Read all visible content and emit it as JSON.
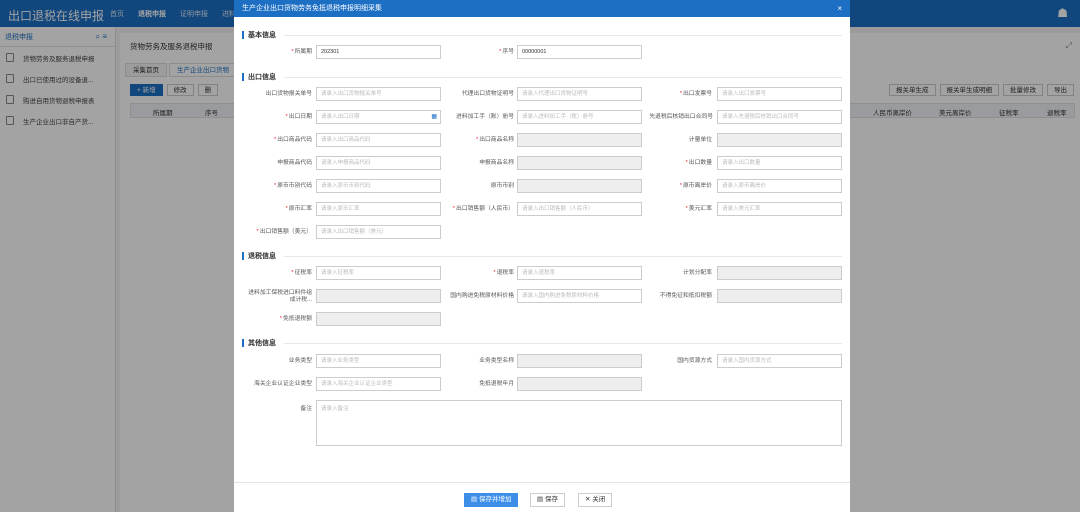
{
  "app": {
    "title": "出口退税在线申报",
    "nav": [
      "首页",
      "退税申报",
      "证明申报",
      "进料"
    ],
    "nav_active": 1,
    "user_icon": "user-icon"
  },
  "sidebar": {
    "title": "退税申报",
    "items": [
      "货物劳务及服务退税申报",
      "出口已使用过的设备退...",
      "购进自用货物退税申报表",
      "生产企业出口非自产货..."
    ]
  },
  "main": {
    "breadcrumb": "货物劳务及服务退税申报",
    "tabs": [
      "采集首页",
      "生产企业出口货物"
    ],
    "toolbar": {
      "new": "+ 新增",
      "edit": "修改",
      "delete": "删"
    },
    "toolbar_right": [
      "报关单生成",
      "报关单生成明细",
      "批量修改",
      "导出"
    ],
    "grid_headers": [
      "所属期",
      "序号",
      "人民币离岸价",
      "美元离岸价",
      "征税率",
      "退税率"
    ]
  },
  "modal": {
    "title": "生产企业出口货物劳务免抵退税申报明细采集",
    "close": "×",
    "sections": {
      "basic": "基本信息",
      "export": "出口信息",
      "refund": "退税信息",
      "other": "其他信息"
    },
    "basic": {
      "period_label": "所属期",
      "period_value": "202301",
      "seq_label": "序号",
      "seq_value": "00000001"
    },
    "export": {
      "customs_no_label": "出口货物报关单号",
      "customs_no_ph": "请录入出口货物报关单号",
      "agent_cert_label": "代理出口货物证明号",
      "agent_cert_ph": "请录入代理出口货物证明号",
      "invoice_label": "出口发票号",
      "invoice_ph": "请录入出口发票号",
      "date_label": "出口日期",
      "date_ph": "请录入出口日期",
      "manual_label": "进料加工手（账）册号",
      "manual_ph": "请录入进料加工手（账）册号",
      "transfer_label": "先退税后核销出口合同号",
      "transfer_ph": "请录入先退税后核销出口合同号",
      "goods_code_label": "出口商品代码",
      "goods_code_ph": "请录入出口商品代码",
      "goods_name_label": "出口商品名称",
      "unit_label": "计量单位",
      "decl_code_label": "申报商品代码",
      "decl_code_ph": "请录入申报商品代码",
      "decl_name_label": "申报商品名称",
      "qty_label": "出口数量",
      "qty_ph": "请录入出口数量",
      "currency_code_label": "原币币别代码",
      "currency_code_ph": "请录入原币币别代码",
      "currency_label": "原币币别",
      "fob_label": "原币离岸价",
      "fob_ph": "请录入原币离岸价",
      "rate_label": "原币汇率",
      "rate_ph": "请录入原币汇率",
      "sales_rmb_label": "出口销售额（人民币）",
      "sales_rmb_ph": "请录入出口销售额（人民币）",
      "usd_rate_label": "美元汇率",
      "usd_rate_ph": "请录入美元汇率",
      "sales_usd_label": "出口销售额（美元）",
      "sales_usd_ph": "请录入出口销售额（美元）"
    },
    "refund": {
      "levy_label": "征税率",
      "levy_ph": "请录入征税率",
      "refund_label": "退税率",
      "refund_ph": "请录入退税率",
      "plan_label": "计划分配率",
      "bonded_label": "进料加工保税进口料件组成计税...",
      "domestic_label": "国内购进免税原材料价格",
      "domestic_ph": "请录入国内购进免税原材料价格",
      "nodeduct_label": "不得免征和抵扣税额",
      "exempt_label": "免抵退税额"
    },
    "other": {
      "biz_type_label": "业务类型",
      "biz_type_ph": "请录入业务类型",
      "biz_name_label": "业务类型名称",
      "source_label": "国内货源方式",
      "source_ph": "请录入国内货源方式",
      "customs_cert_label": "海关企业认证企业类型",
      "customs_cert_ph": "请录入海关企业认证企业类型",
      "exempt_period_label": "免抵退税年月",
      "remark_label": "备注",
      "remark_ph": "请录入备注"
    },
    "footer": {
      "save_add": "保存并增加",
      "save": "保存",
      "close": "关闭"
    }
  }
}
